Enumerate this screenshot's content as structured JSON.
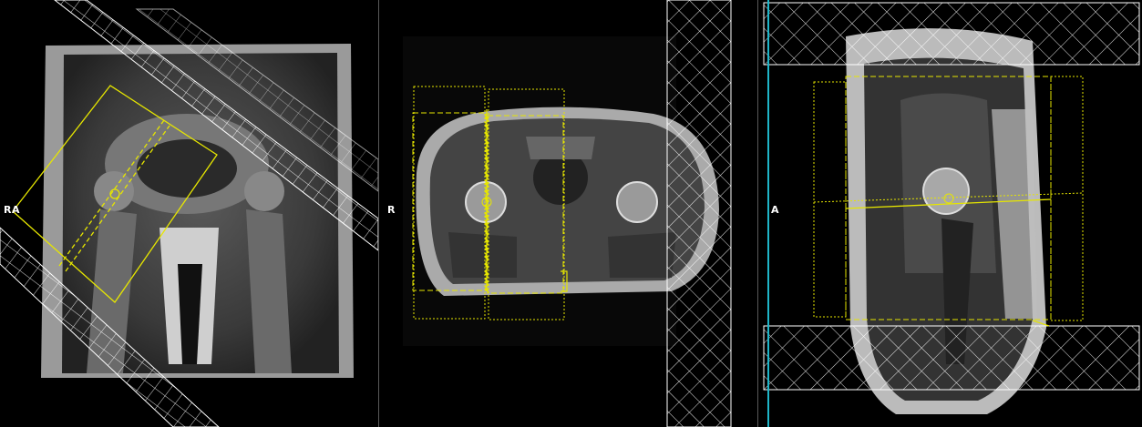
{
  "viewports": {
    "coronal": {
      "orientation_label": "RA"
    },
    "axial": {
      "orientation_label": "R"
    },
    "sagittal": {
      "orientation_label": "A"
    }
  },
  "colors": {
    "planning_box": "#e6e600",
    "saturation_band": "#ffffff",
    "divider": "#5a5a5a",
    "sagittal_edge_line": "#1fb6c9"
  }
}
